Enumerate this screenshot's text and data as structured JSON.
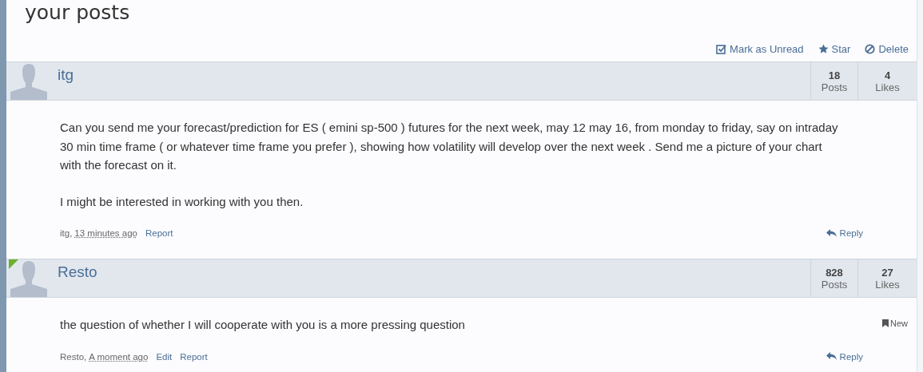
{
  "title": "your posts",
  "actions": [
    {
      "kind": "check",
      "label": "Mark as Unread"
    },
    {
      "kind": "star",
      "label": "Star"
    },
    {
      "kind": "delete",
      "label": "Delete"
    }
  ],
  "posts": [
    {
      "author": "itg",
      "online": false,
      "posts": "18",
      "posts_label": "Posts",
      "likes": "4",
      "likes_label": "Likes",
      "paragraphs": [
        "Can you send me your forecast/prediction for ES ( emini sp-500 ) futures for the next week, may 12 may 16, from monday to friday, say on intraday 30 min time frame ( or whatever time frame you prefer ), showing how volatility will develop over the next week . Send me a picture of your chart with the forecast on it.",
        "I might be interested in working with you then."
      ],
      "new": false,
      "byline": "itg,",
      "time": "13 minutes ago",
      "links": [
        "Report"
      ],
      "reply": "Reply"
    },
    {
      "author": "Resto",
      "online": true,
      "posts": "828",
      "posts_label": "Posts",
      "likes": "27",
      "likes_label": "Likes",
      "paragraphs": [
        "the question of whether I will cooperate with you is a more pressing question"
      ],
      "new": true,
      "new_label": "New",
      "byline": "Resto,",
      "time": "A moment ago",
      "links": [
        "Edit",
        "Report"
      ],
      "reply": "Reply"
    }
  ]
}
